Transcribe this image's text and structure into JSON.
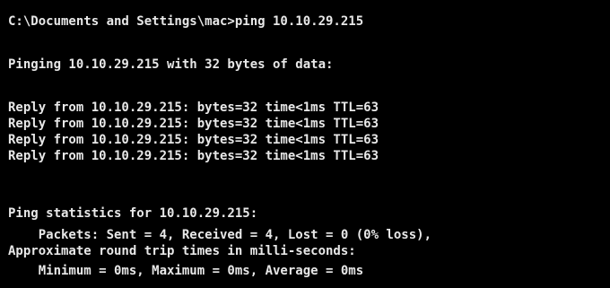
{
  "window": {
    "background": "#000000",
    "text_color": "#e8e8e8"
  },
  "console": {
    "command_line": "C:\\Documents and Settings\\mac>ping 10.10.29.215",
    "pinging_line": "Pinging 10.10.29.215 with 32 bytes of data:",
    "replies": [
      "Reply from 10.10.29.215: bytes=32 time<1ms TTL=63",
      "Reply from 10.10.29.215: bytes=32 time<1ms TTL=63",
      "Reply from 10.10.29.215: bytes=32 time<1ms TTL=63",
      "Reply from 10.10.29.215: bytes=32 time<1ms TTL=63"
    ],
    "statistics_header": "Ping statistics for 10.10.29.215:",
    "packets_line": "    Packets: Sent = 4, Received = 4, Lost = 0 (0% loss),",
    "approx_header": "Approximate round trip times in milli-seconds:",
    "times_line": "    Minimum = 0ms, Maximum = 0ms, Average = 0ms"
  }
}
